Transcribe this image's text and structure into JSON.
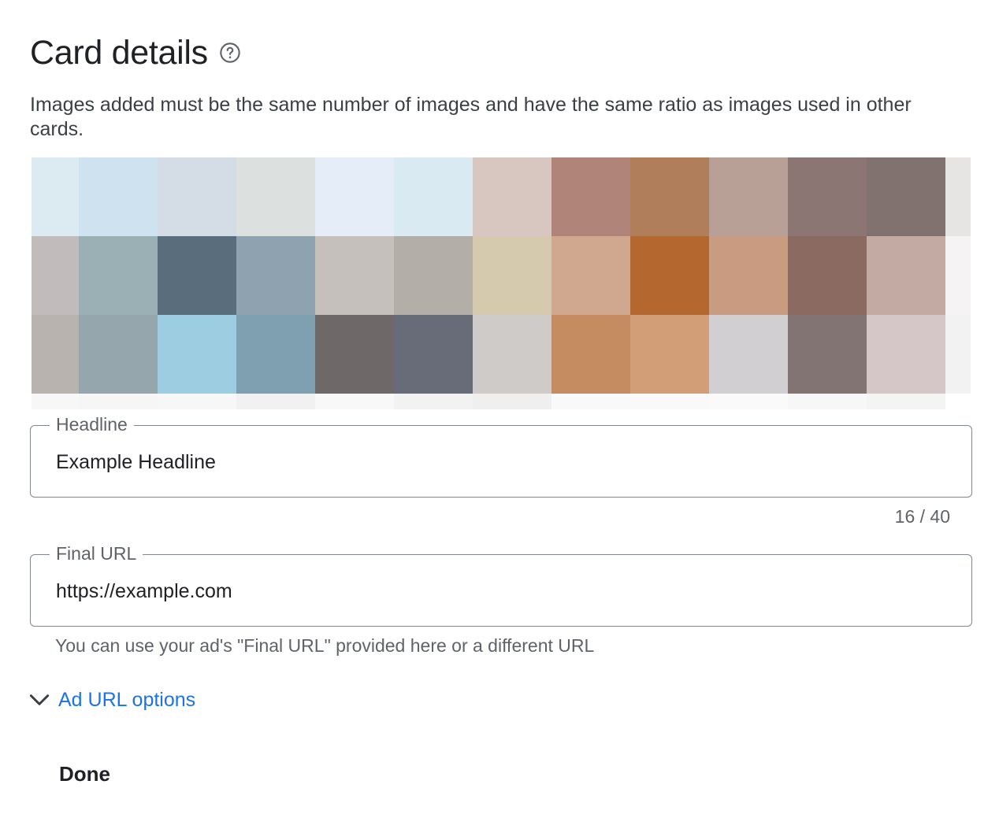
{
  "header": {
    "title": "Card details",
    "help_icon": "help-circle-icon"
  },
  "description": "Images added must be the same number of images and have the same ratio as images used in other cards.",
  "image_preview": {
    "icon": "pixelated-image-thumbnail",
    "colors": [
      [
        "#dcebf2",
        "#cee2ef",
        "#d4dce6",
        "#dce0de",
        "#e5eef8",
        "#d9eaf3",
        "#d8c6c0",
        "#b08478",
        "#b07e5a",
        "#b8a096",
        "#8c7674",
        "#817270",
        "#e7e5e4"
      ],
      [
        "#c2bbbb",
        "#9ab0b5",
        "#5a6d7d",
        "#8ea3af",
        "#c5c0bb",
        "#b4aea8",
        "#d5caae",
        "#d0a88f",
        "#b4672e",
        "#c99b80",
        "#8b6a61",
        "#c3aaa2",
        "#f5f3f3"
      ],
      [
        "#b8b3ae",
        "#95a6ad",
        "#9ccde0",
        "#7ea0b1",
        "#6e6868",
        "#676c78",
        "#cfcbc8",
        "#c48c60",
        "#d29e78",
        "#d1cfd1",
        "#837474",
        "#d5c7c8",
        "#f3f2f2"
      ],
      [
        "#f7f7f7",
        "#f6f6f6",
        "#f7f7f7",
        "#f1f1f1",
        "#f8f8f8",
        "#f2f2f2",
        "#efefef",
        "#f9f9f9",
        "#f9f9f9",
        "#fafafa",
        "#f7f7f7",
        "#f4f4f4",
        "#ffffff"
      ]
    ]
  },
  "headline": {
    "label": "Headline",
    "value": "Example Headline",
    "counter": "16 / 40"
  },
  "final_url": {
    "label": "Final URL",
    "value": "https://example.com",
    "hint": "You can use your ad's \"Final URL\" provided here or a different URL"
  },
  "url_options": {
    "label": "Ad URL options",
    "icon": "chevron-down-icon"
  },
  "done_label": "Done"
}
